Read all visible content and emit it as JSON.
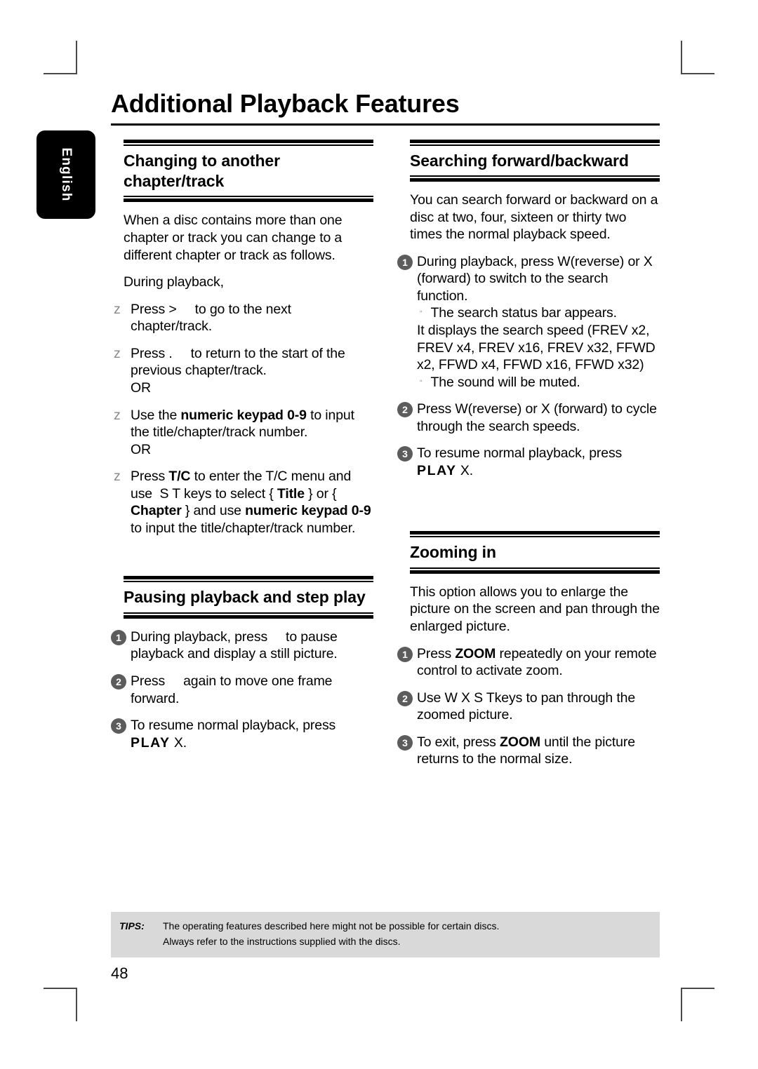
{
  "page": {
    "title": "Additional Playback Features",
    "number": "48",
    "language_tab": "English"
  },
  "left_column": {
    "section1": {
      "heading": "Changing to another chapter/track",
      "intro": "When a disc contains more than one chapter or track you can change to a different chapter or track as follows.",
      "during": "During playback,",
      "bullets": [
        {
          "marker": "z",
          "parts": [
            {
              "t": "Press >",
              "bold": false
            },
            {
              "t": "GAP",
              "bold": false
            },
            {
              "t": "to go to the next chapter/track.",
              "bold": false
            }
          ]
        },
        {
          "marker": "z",
          "parts": [
            {
              "t": "Press .",
              "bold": false
            },
            {
              "t": "GAP",
              "bold": false
            },
            {
              "t": "to return to the start of the previous chapter/track.",
              "bold": false
            },
            {
              "t": "OR",
              "bold": false
            }
          ]
        },
        {
          "marker": "z",
          "parts": [
            {
              "t": "Use the ",
              "bold": false
            },
            {
              "t": "numeric keypad 0-9",
              "bold": true
            },
            {
              "t": " to input the title/chapter/track number.",
              "bold": false
            },
            {
              "t": "OR",
              "bold": false
            }
          ]
        },
        {
          "marker": "z",
          "parts": [
            {
              "t": "Press ",
              "bold": false
            },
            {
              "t": "T/C",
              "bold": true
            },
            {
              "t": " to enter the T/C menu and use  S T keys to select { ",
              "bold": false
            },
            {
              "t": "Title",
              "bold": true
            },
            {
              "t": " } or { ",
              "bold": false
            },
            {
              "t": "Chapter",
              "bold": true
            },
            {
              "t": " } and use ",
              "bold": false
            },
            {
              "t": "numeric keypad 0-9",
              "bold": true
            },
            {
              "t": " to input the title/chapter/track number.",
              "bold": false
            }
          ]
        }
      ]
    },
    "section2": {
      "heading": "Pausing playback and step play",
      "steps": [
        {
          "num": "1",
          "text_a": "During playback, press",
          "text_b": "to pause playback and display a still picture."
        },
        {
          "num": "2",
          "text_a": "Press",
          "text_b": "again to move one frame forward."
        },
        {
          "num": "3",
          "text_a": "To resume normal playback, press",
          "play": "PLAY",
          "after": "X."
        }
      ]
    }
  },
  "right_column": {
    "section1": {
      "heading": "Searching forward/backward",
      "intro": "You can search forward or backward on a disc at two, four, sixteen or thirty two times the normal playback speed.",
      "steps": [
        {
          "num": "1",
          "text": "During playback, press  W(reverse) or  X (forward) to switch to the search function.",
          "sub1": "The search status bar appears.",
          "detail": "It displays the search speed (FREV x2, FREV x4, FREV x16, FREV x32, FFWD x2, FFWD x4, FFWD x16, FFWD x32)",
          "sub2": "The sound will be muted."
        },
        {
          "num": "2",
          "text": "Press  W(reverse) or  X (forward) to cycle through the search speeds."
        },
        {
          "num": "3",
          "text": "To resume normal playback, press",
          "play": "PLAY",
          "after": "X."
        }
      ]
    },
    "section2": {
      "heading": "Zooming in",
      "intro": "This option allows you to enlarge the picture on the screen and pan through the enlarged picture.",
      "steps": [
        {
          "num": "1",
          "pre": "Press ",
          "bold": "ZOOM",
          "post": " repeatedly on your remote control to activate zoom."
        },
        {
          "num": "2",
          "pre": "Use  W X S Tkeys to pan through the zoomed picture.",
          "bold": "",
          "post": ""
        },
        {
          "num": "3",
          "pre": "To exit, press ",
          "bold": "ZOOM",
          "post": " until the picture returns to the normal size."
        }
      ]
    }
  },
  "tips": {
    "label": "TIPS:",
    "line1": "The operating features described here might not be possible for certain discs.",
    "line2": "Always refer to the instructions supplied with the discs."
  },
  "colors": {
    "tips_background": "#d9d9d9",
    "step_circle": "#5c5c5c",
    "crop_mark": "#4a4a4a",
    "tab_background": "#000000"
  }
}
